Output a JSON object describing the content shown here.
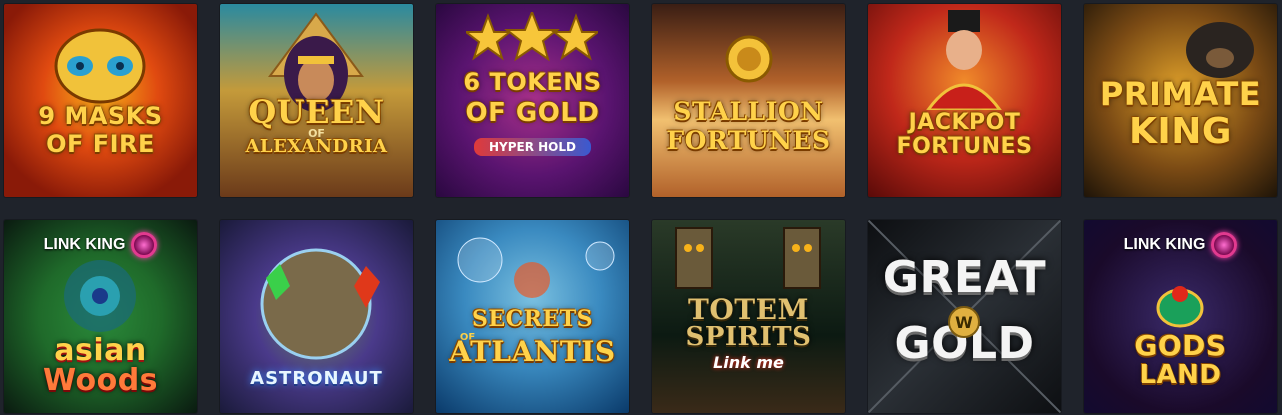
{
  "games": [
    {
      "title_lines": [
        "9 MASKS",
        "OF FIRE"
      ],
      "sub": "",
      "colors": [
        "#8a1a08",
        "#e04a10",
        "#f7b21a"
      ]
    },
    {
      "title_lines": [
        "QUEEN",
        "ALEXANDRIA"
      ],
      "small": "OF",
      "sub": "",
      "colors": [
        "#1e6a80",
        "#c49a3a",
        "#6b3a1a"
      ]
    },
    {
      "title_lines": [
        "6 TOKENS",
        "OF GOLD"
      ],
      "sub": "HYPER HOLD",
      "colors": [
        "#3a0b55",
        "#7a1a6a",
        "#f2b43a"
      ]
    },
    {
      "title_lines": [
        "STALLION",
        "FORTUNES"
      ],
      "sub": "",
      "colors": [
        "#3a1e14",
        "#b1612a",
        "#f1c070"
      ]
    },
    {
      "title_lines": [
        "JACKPOT",
        "FORTUNES"
      ],
      "sub": "",
      "colors": [
        "#5a0a08",
        "#c0281a",
        "#f08a2a"
      ]
    },
    {
      "title_lines": [
        "PRIMATE",
        "KING"
      ],
      "sub": "",
      "colors": [
        "#1e1408",
        "#7a4a14",
        "#e0a12a"
      ]
    },
    {
      "title_lines": [
        "asian",
        "Woods"
      ],
      "sub": "",
      "linkking": "LINK KING",
      "colors": [
        "#0e3012",
        "#1f6a2a",
        "#0a1a10"
      ]
    },
    {
      "title_lines": [
        "ASTRONAUT"
      ],
      "sub": "",
      "colors": [
        "#1a1a3a",
        "#4a3a8a",
        "#1aa0c0"
      ]
    },
    {
      "title_lines": [
        "SECRETS",
        "ATLANTIS"
      ],
      "small": "OF",
      "sub": "",
      "colors": [
        "#0a3a6a",
        "#3a8ac0",
        "#7ac0e0"
      ]
    },
    {
      "title_lines": [
        "TOTEM",
        "SPIRITS"
      ],
      "sub": "Link me",
      "colors": [
        "#0c1a12",
        "#2a3a28",
        "#6a5a3a"
      ]
    },
    {
      "title_lines": [
        "GREAT",
        "GOLD"
      ],
      "sub": "",
      "colors": [
        "#0d0f12",
        "#2a2f35",
        "#565c63"
      ]
    },
    {
      "title_lines": [
        "GODS",
        "LAND"
      ],
      "sub": "",
      "linkking": "LINK KING",
      "colors": [
        "#120a30",
        "#3a2a6a",
        "#1a0a2a"
      ]
    }
  ]
}
